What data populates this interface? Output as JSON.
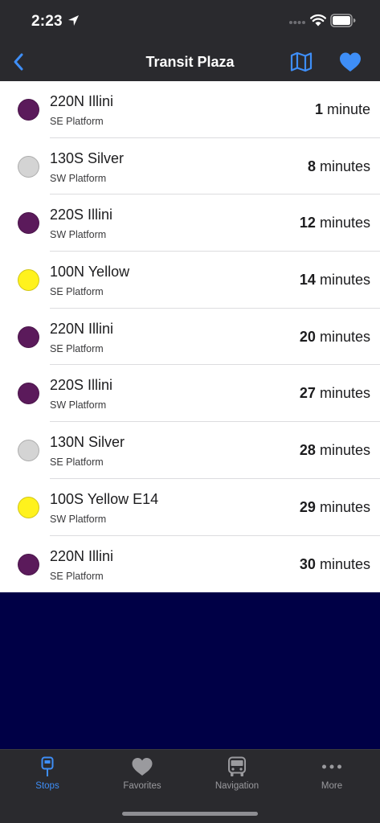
{
  "status": {
    "time": "2:23",
    "icons": [
      "location-arrow-icon",
      "signal-dots-icon",
      "wifi-icon",
      "battery-icon"
    ]
  },
  "nav": {
    "title": "Transit Plaza",
    "back_icon": "chevron-left-icon",
    "map_icon": "map-icon",
    "favorite_icon": "heart-icon"
  },
  "colors": {
    "accent": "#3e8ef7",
    "bar_background": "#2a2a2e",
    "page_background": "#000046",
    "illini": "#5b1a5b",
    "silver": "#d4d4d4",
    "yellow": "#fff21d"
  },
  "departures": [
    {
      "route": "220N Illini",
      "platform": "SE Platform",
      "eta_num": "1",
      "eta_unit": "minute",
      "color": "#5b1a5b"
    },
    {
      "route": "130S Silver",
      "platform": "SW Platform",
      "eta_num": "8",
      "eta_unit": "minutes",
      "color": "#d4d4d4"
    },
    {
      "route": "220S Illini",
      "platform": "SW Platform",
      "eta_num": "12",
      "eta_unit": "minutes",
      "color": "#5b1a5b"
    },
    {
      "route": "100N Yellow",
      "platform": "SE Platform",
      "eta_num": "14",
      "eta_unit": "minutes",
      "color": "#fff21d"
    },
    {
      "route": "220N Illini",
      "platform": "SE Platform",
      "eta_num": "20",
      "eta_unit": "minutes",
      "color": "#5b1a5b"
    },
    {
      "route": "220S Illini",
      "platform": "SW Platform",
      "eta_num": "27",
      "eta_unit": "minutes",
      "color": "#5b1a5b"
    },
    {
      "route": "130N Silver",
      "platform": "SE Platform",
      "eta_num": "28",
      "eta_unit": "minutes",
      "color": "#d4d4d4"
    },
    {
      "route": "100S Yellow E14",
      "platform": "SW Platform",
      "eta_num": "29",
      "eta_unit": "minutes",
      "color": "#fff21d"
    },
    {
      "route": "220N Illini",
      "platform": "SE Platform",
      "eta_num": "30",
      "eta_unit": "minutes",
      "color": "#5b1a5b"
    }
  ],
  "tabs": [
    {
      "label": "Stops",
      "icon": "bus-stop-icon",
      "active": true
    },
    {
      "label": "Favorites",
      "icon": "heart-icon",
      "active": false
    },
    {
      "label": "Navigation",
      "icon": "bus-icon",
      "active": false
    },
    {
      "label": "More",
      "icon": "more-dots-icon",
      "active": false
    }
  ]
}
